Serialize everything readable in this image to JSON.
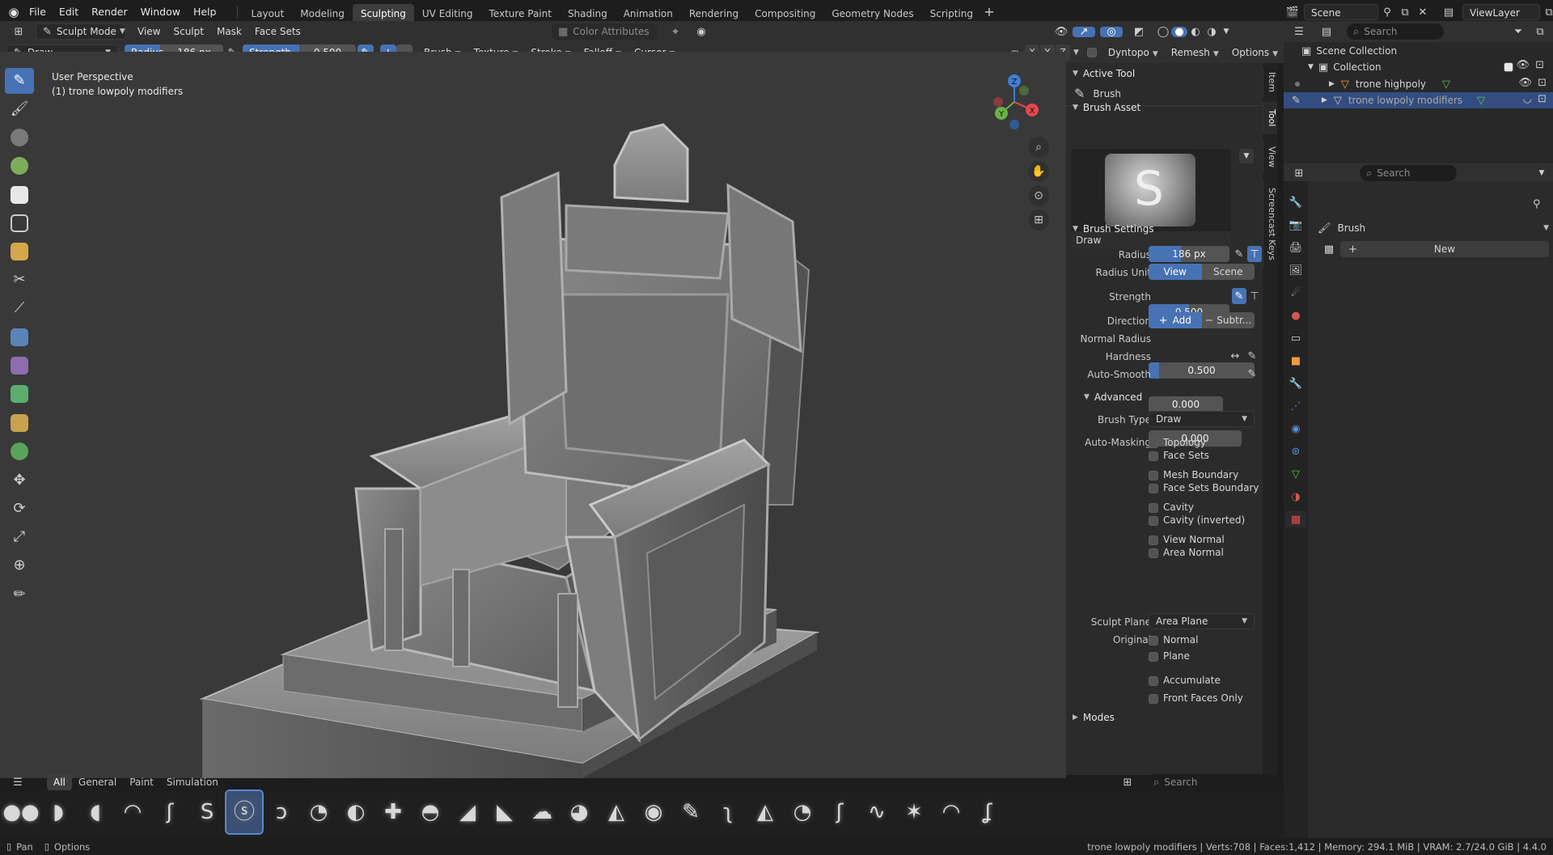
{
  "menubar": {
    "items": [
      "File",
      "Edit",
      "Render",
      "Window",
      "Help"
    ],
    "workspaces": [
      "Layout",
      "Modeling",
      "Sculpting",
      "UV Editing",
      "Texture Paint",
      "Shading",
      "Animation",
      "Rendering",
      "Compositing",
      "Geometry Nodes",
      "Scripting"
    ],
    "active_workspace": "Sculpting",
    "scene": "Scene",
    "view_layer": "ViewLayer"
  },
  "viewport_header": {
    "mode": "Sculpt Mode",
    "menus": [
      "View",
      "Sculpt",
      "Mask",
      "Face Sets"
    ],
    "color_attributes": "Color Attributes"
  },
  "tool_header": {
    "tool": "Draw",
    "radius_label": "Radius",
    "radius_value": "186 px",
    "strength_label": "Strength",
    "strength_value": "0.500",
    "strength_fraction": 0.5,
    "popovers": [
      "Brush",
      "Texture",
      "Stroke",
      "Falloff",
      "Cursor"
    ],
    "axes": [
      "X",
      "Y",
      "Z"
    ],
    "dyntopo": "Dyntopo",
    "remesh": "Remesh",
    "options": "Options"
  },
  "viewport": {
    "overlay_title": "User Perspective",
    "overlay_object": "(1) trone lowpoly modifiers",
    "gizmo_axes": [
      "X",
      "Y",
      "Z"
    ]
  },
  "npanel": {
    "tabs": [
      "Item",
      "Tool",
      "View",
      "Screencast Keys"
    ],
    "active_tool_header": "Active Tool",
    "active_tool_name": "Brush",
    "brush_asset_header": "Brush Asset",
    "brush_asset_name": "Draw",
    "brush_settings_header": "Brush Settings",
    "radius_label": "Radius",
    "radius_value": "186 px",
    "radius_unit_label": "Radius Unit",
    "radius_unit_options": [
      "View",
      "Scene"
    ],
    "strength_label": "Strength",
    "strength_value": "0.500",
    "strength_fraction": 0.5,
    "direction_label": "Direction",
    "direction_add": "Add",
    "direction_sub": "Subtr...",
    "normal_radius_label": "Normal Radius",
    "normal_radius_value": "0.500",
    "normal_radius_fraction": 0.5,
    "hardness_label": "Hardness",
    "hardness_value": "0.000",
    "auto_smooth_label": "Auto-Smooth",
    "auto_smooth_value": "0.000",
    "advanced_header": "Advanced",
    "brush_type_label": "Brush Type",
    "brush_type_value": "Draw",
    "auto_masking_label": "Auto-Masking",
    "auto_masking": [
      "Topology",
      "Face Sets",
      "Mesh Boundary",
      "Face Sets Boundary",
      "Cavity",
      "Cavity (inverted)",
      "View Normal",
      "Area Normal"
    ],
    "sculpt_plane_label": "Sculpt Plane",
    "sculpt_plane_value": "Area Plane",
    "original_label": "Original",
    "original_options": [
      "Normal",
      "Plane"
    ],
    "accumulate": "Accumulate",
    "front_faces_only": "Front Faces Only",
    "modes_header": "Modes"
  },
  "outliner": {
    "search_placeholder": "Search",
    "scene_collection": "Scene Collection",
    "collection": "Collection",
    "objects": [
      "trone highpoly",
      "trone lowpoly modifiers"
    ]
  },
  "properties": {
    "search_placeholder": "Search",
    "brush_label": "Brush",
    "new_button": "New"
  },
  "asset_shelf": {
    "tabs": [
      "All",
      "General",
      "Paint",
      "Simulation"
    ],
    "active_tab": "All",
    "search_placeholder": "Search"
  },
  "statusbar": {
    "left_pan": "Pan",
    "left_options": "Options",
    "right": "trone lowpoly modifiers | Verts:708 | Faces:1,412 | Memory: 294.1 MiB | VRAM: 2.7/24.0 GiB | 4.4.0"
  },
  "colors": {
    "accent": "#4772b3",
    "x_axis": "#e5484d",
    "y_axis": "#6ab24a",
    "z_axis": "#3d7fd6",
    "vert_green": "#5fbf4f"
  }
}
